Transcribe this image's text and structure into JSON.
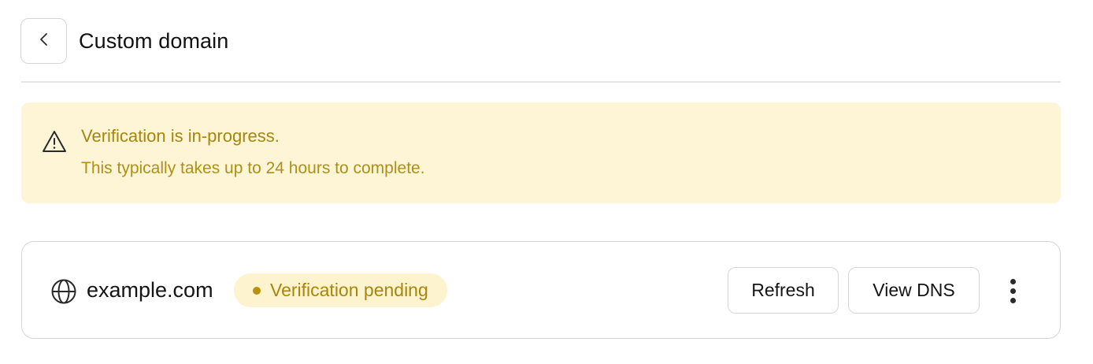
{
  "header": {
    "title": "Custom domain",
    "back_icon": "chevron-left-icon"
  },
  "banner": {
    "icon": "warning-triangle-icon",
    "title": "Verification is in-progress.",
    "message": "This typically takes up to 24 hours to complete.",
    "background_color": "#fdf5d6",
    "text_color": "#a8860a"
  },
  "domain": {
    "icon": "globe-icon",
    "name": "example.com",
    "status": "Verification pending",
    "status_color": "#b8920c",
    "actions": {
      "refresh_label": "Refresh",
      "view_dns_label": "View DNS",
      "more_icon": "more-vertical-icon"
    }
  }
}
